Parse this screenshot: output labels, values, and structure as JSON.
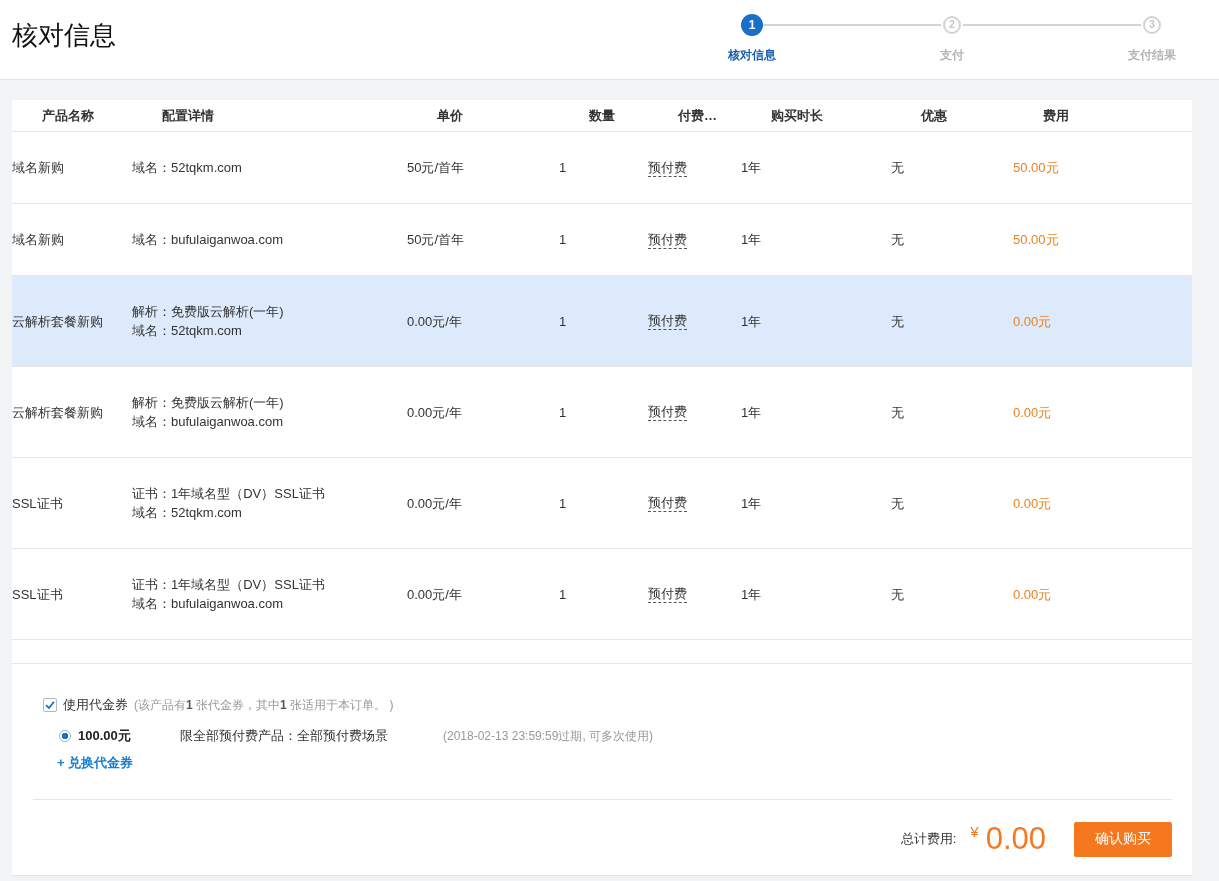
{
  "page": {
    "title": "核对信息"
  },
  "steps": [
    {
      "number": "1",
      "label": "核对信息",
      "selected": true
    },
    {
      "number": "2",
      "label": "支付",
      "selected": false
    },
    {
      "number": "3",
      "label": "支付结果",
      "selected": false
    }
  ],
  "table": {
    "columns": [
      "产品名称",
      "配置详情",
      "单价",
      "数量",
      "付费…",
      "购买时长",
      "优惠",
      "费用"
    ],
    "rows": [
      {
        "selected": false,
        "product": "域名新购",
        "details": [
          "域名：52tqkm.com"
        ],
        "price": "50元/首年",
        "quantity": "1",
        "payment_type": "预付费",
        "duration": "1年",
        "discount": "无",
        "cost": "50.00元"
      },
      {
        "selected": false,
        "product": "域名新购",
        "details": [
          "域名：bufulaiganwoa.com"
        ],
        "price": "50元/首年",
        "quantity": "1",
        "payment_type": "预付费",
        "duration": "1年",
        "discount": "无",
        "cost": "50.00元"
      },
      {
        "selected": true,
        "product": "云解析套餐新购",
        "details": [
          "解析：免费版云解析(一年)",
          "域名：52tqkm.com"
        ],
        "price": "0.00元/年",
        "quantity": "1",
        "payment_type": "预付费",
        "duration": "1年",
        "discount": "无",
        "cost": "0.00元"
      },
      {
        "selected": false,
        "product": "云解析套餐新购",
        "details": [
          "解析：免费版云解析(一年)",
          "域名：bufulaiganwoa.com"
        ],
        "price": "0.00元/年",
        "quantity": "1",
        "payment_type": "预付费",
        "duration": "1年",
        "discount": "无",
        "cost": "0.00元"
      },
      {
        "selected": false,
        "product": "SSL证书",
        "details": [
          "证书：1年域名型（DV）SSL证书",
          "域名：52tqkm.com"
        ],
        "price": "0.00元/年",
        "quantity": "1",
        "payment_type": "预付费",
        "duration": "1年",
        "discount": "无",
        "cost": "0.00元"
      },
      {
        "selected": false,
        "product": "SSL证书",
        "details": [
          "证书：1年域名型（DV）SSL证书",
          "域名：bufulaiganwoa.com"
        ],
        "price": "0.00元/年",
        "quantity": "1",
        "payment_type": "预付费",
        "duration": "1年",
        "discount": "无",
        "cost": "0.00元"
      }
    ]
  },
  "voucher": {
    "checked": true,
    "label": "使用代金券",
    "note": "(该产品有**1** 张代金券，其中**1** 张适用于本订单。 )",
    "options": [
      {
        "selected": true,
        "amount": "100.00元",
        "scope": "限全部预付费产品：全部预付费场景",
        "expiry": "(2018-02-13 23:59:59过期, 可多次使用)"
      }
    ],
    "redeem_link": "+ 兑换代金券"
  },
  "footer": {
    "total_label": "总计费用:",
    "currency": "¥",
    "total": "0.00",
    "confirm_button": "确认购买"
  }
}
